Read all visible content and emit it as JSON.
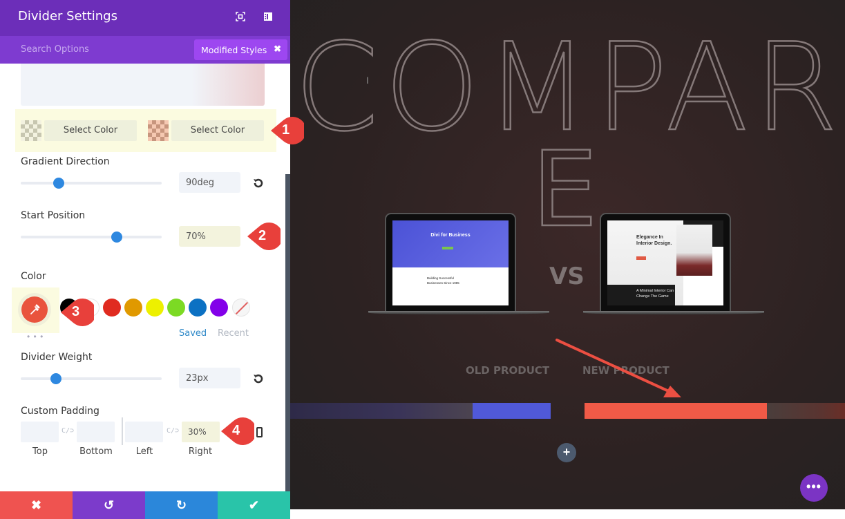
{
  "panel": {
    "title": "Divider Settings",
    "header_icons": [
      "expand-icon",
      "sidebar-toggle-icon"
    ],
    "search": {
      "placeholder": "Search Options"
    },
    "filter_chip": {
      "label": "Modified Styles",
      "close": "✖"
    },
    "gradient_preview": {
      "start_color": "#f1f4f9",
      "end_color": "#eccfd1"
    },
    "gradient_colors": [
      {
        "label": "Select Color",
        "swatch": "transparent-checker"
      },
      {
        "label": "Select Color",
        "swatch": "peach-checker"
      }
    ],
    "gradient_direction": {
      "label": "Gradient Direction",
      "value": "90deg",
      "slider_fraction": 0.27
    },
    "start_position": {
      "label": "Start Position",
      "value": "70%",
      "slider_fraction": 0.68
    },
    "color": {
      "label": "Color",
      "active_color": "#e9533d",
      "more": "• • •",
      "palette": [
        "#000000",
        "#ffffff",
        "#e02b20",
        "#e09900",
        "#edf000",
        "#7cda24",
        "#0c71c3",
        "#8300e9"
      ],
      "tabs": {
        "saved": "Saved",
        "recent": "Recent"
      }
    },
    "divider_weight": {
      "label": "Divider Weight",
      "value": "23px",
      "slider_fraction": 0.25
    },
    "custom_padding": {
      "label": "Custom Padding",
      "fields": [
        {
          "label": "Top",
          "value": ""
        },
        {
          "label": "Bottom",
          "value": ""
        },
        {
          "label": "Left",
          "value": ""
        },
        {
          "label": "Right",
          "value": "30%"
        }
      ]
    },
    "footer": {
      "cancel": "✖",
      "undo": "↺",
      "redo": "↻",
      "save": "✔"
    }
  },
  "callouts": [
    "1",
    "2",
    "3",
    "4"
  ],
  "canvas": {
    "heading_line1": "COMPAR",
    "heading_line2": "E",
    "vs": "VS",
    "old_product": {
      "label": "OLD PRODUCT",
      "screen_title": "Divi for Business",
      "screen_sub": "Building Successful Businesses Since 1985",
      "bar_color": "#5059d8"
    },
    "new_product": {
      "label": "NEW PRODUCT",
      "screen_title": "Elegance In Interior Design.",
      "screen_box": "A Minimal Interior Can Change The Game",
      "bar_color": "#f05a47"
    },
    "add_label": "+",
    "more_label": "•••"
  }
}
